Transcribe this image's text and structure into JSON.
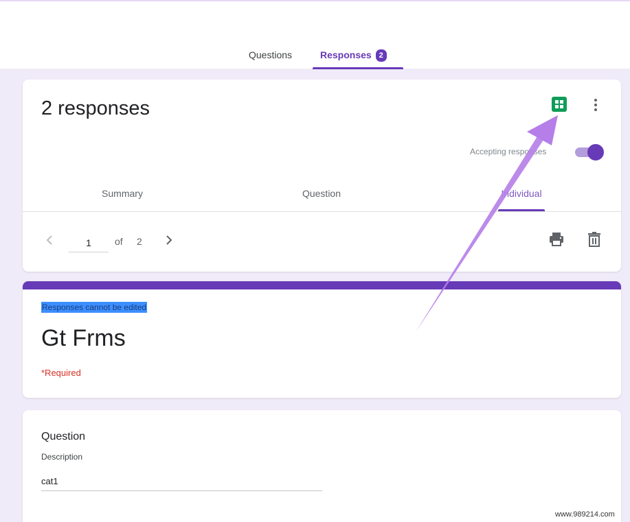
{
  "header": {
    "tabs": [
      {
        "label": "Questions"
      },
      {
        "label": "Responses",
        "badge": "2"
      }
    ]
  },
  "responses_card": {
    "title": "2 responses",
    "accepting_label": "Accepting responses",
    "accepting": true,
    "subtabs": [
      {
        "label": "Summary"
      },
      {
        "label": "Question"
      },
      {
        "label": "Individual"
      }
    ],
    "pagination": {
      "current": "1",
      "of_label": "of",
      "total": "2"
    }
  },
  "form_card": {
    "notice": "Responses cannot be edited",
    "title": "Gt Frms",
    "required_label": "*Required"
  },
  "question_card": {
    "title": "Question",
    "description": "Description",
    "answer": "cat1"
  },
  "watermark": "www.989214.com",
  "colors": {
    "accent": "#673ab7",
    "background": "#f0ebf8",
    "sheets_green": "#0f9d58",
    "required_red": "#d93025",
    "annotation_arrow": "#b57ee8"
  },
  "icons": [
    "sheets-icon",
    "more-vert-icon",
    "chevron-left-icon",
    "chevron-right-icon",
    "print-icon",
    "delete-icon",
    "annotation-arrow"
  ]
}
